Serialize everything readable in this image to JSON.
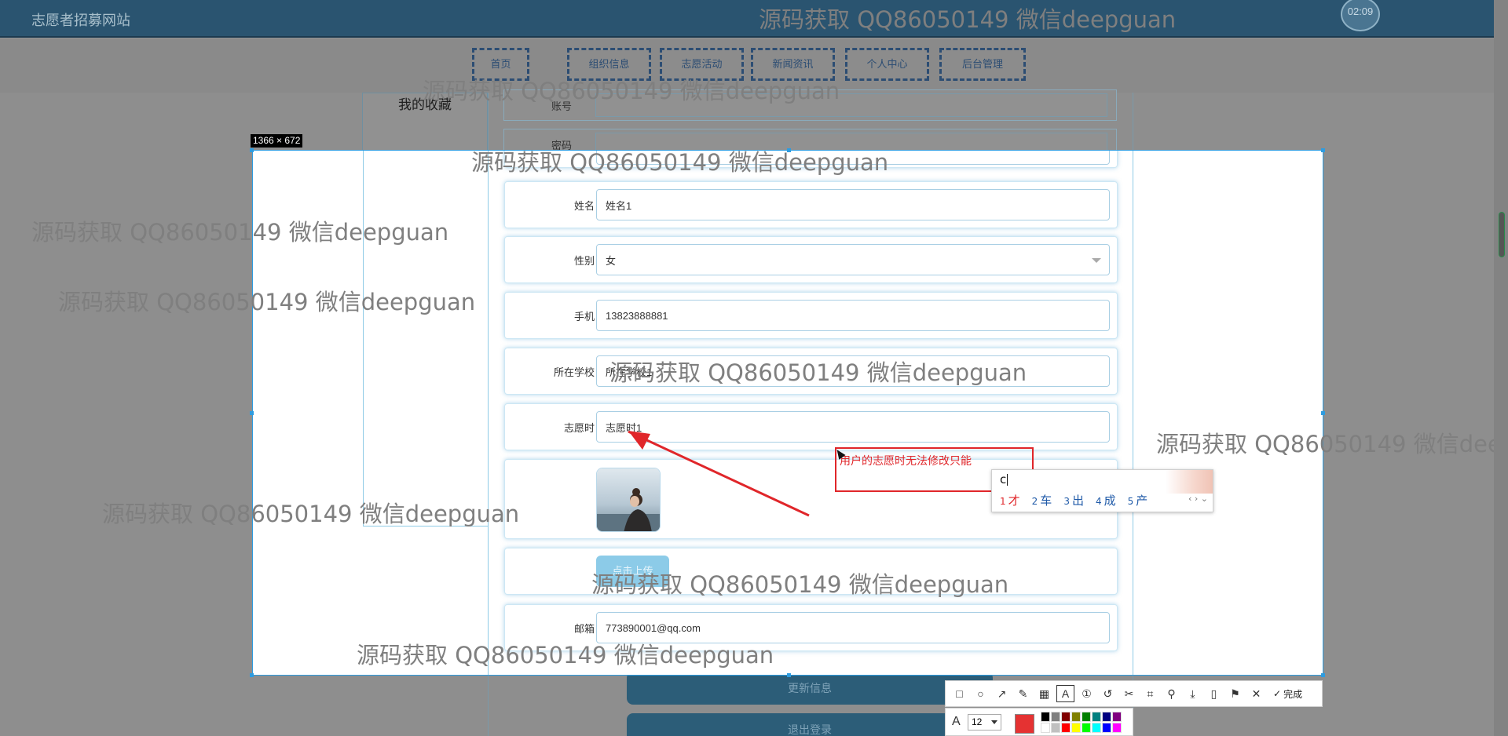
{
  "site": {
    "title": "志愿者招募网站",
    "clock": "02:09"
  },
  "nav": [
    {
      "label": "首页"
    },
    {
      "label": "组织信息"
    },
    {
      "label": "志愿活动"
    },
    {
      "label": "新闻资讯"
    },
    {
      "label": "个人中心"
    },
    {
      "label": "后台管理"
    }
  ],
  "sidebar": {
    "active_item": "我的收藏"
  },
  "background_form": {
    "account_label": "账号",
    "password_label": "密码",
    "update_button": "更新信息",
    "logout_button": "退出登录"
  },
  "capture": {
    "size_label": "1366 × 672"
  },
  "form": {
    "name": {
      "label": "姓名",
      "value": "姓名1"
    },
    "gender": {
      "label": "性别",
      "value": "女"
    },
    "phone": {
      "label": "手机",
      "value": "13823888881"
    },
    "school": {
      "label": "所在学校",
      "value": "所在学校1"
    },
    "volunteer_hours": {
      "label": "志愿时",
      "value": "志愿时1"
    },
    "upload_button": "点击上传",
    "email": {
      "label": "邮箱",
      "value": "773890001@qq.com"
    }
  },
  "annotation": {
    "text": "用户的志愿时无法修改只能",
    "color": "#e0262a"
  },
  "ime": {
    "input": "c",
    "candidates": [
      {
        "num": "1",
        "text": "才"
      },
      {
        "num": "2",
        "text": "车"
      },
      {
        "num": "3",
        "text": "出"
      },
      {
        "num": "4",
        "text": "成"
      },
      {
        "num": "5",
        "text": "产"
      }
    ],
    "nav": "‹ › ⌄"
  },
  "toolbar": {
    "tools": [
      "rectangle-icon",
      "ellipse-icon",
      "arrow-icon",
      "pen-icon",
      "mosaic-icon",
      "text-icon",
      "number-icon",
      "undo-icon",
      "cut-icon",
      "ocr-icon",
      "pin-icon",
      "download-icon",
      "phone-icon",
      "bookmark-icon",
      "close-icon"
    ],
    "done_label": "完成",
    "font_size": "12",
    "current_color": "#e53232",
    "palette": [
      "#000000",
      "#808080",
      "#800000",
      "#808000",
      "#008000",
      "#008080",
      "#000080",
      "#800080",
      "#ffffff",
      "#c0c0c0",
      "#ff0000",
      "#ffff00",
      "#00ff00",
      "#00ffff",
      "#0000ff",
      "#ff00ff"
    ]
  },
  "watermark": "源码获取 QQ86050149 微信deepguan"
}
